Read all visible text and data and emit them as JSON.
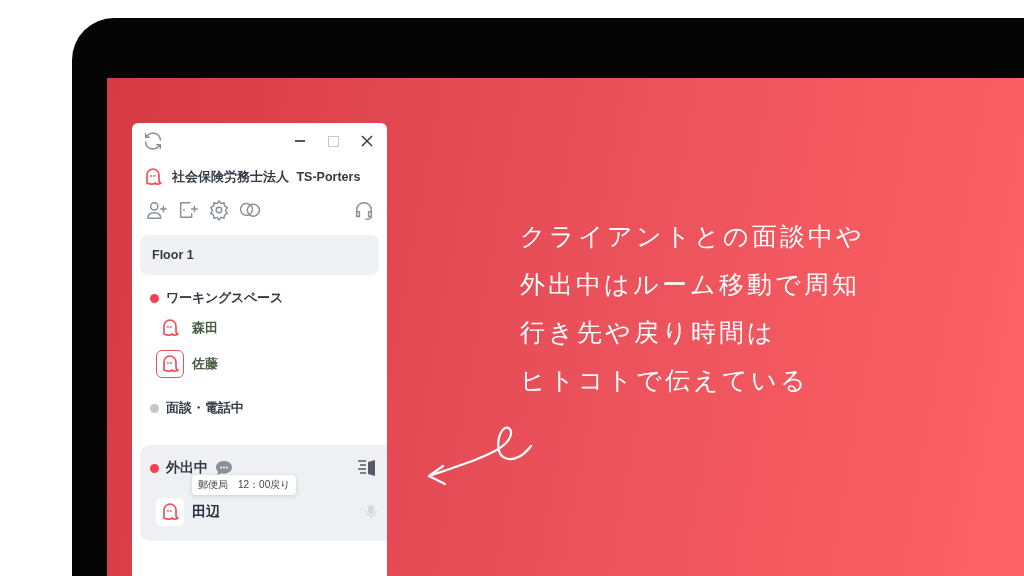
{
  "app": {
    "org_name": "社会保険労務士法人",
    "org_code": "TS-Porters",
    "floor": "Floor 1",
    "rooms": [
      {
        "name": "ワーキングスペース",
        "color": "#f0434f",
        "selected": false,
        "members": [
          {
            "name": "森田",
            "selected": false
          },
          {
            "name": "佐藤",
            "selected": true
          }
        ]
      },
      {
        "name": "面談・電話中",
        "color": "#c4c6cc",
        "selected": false
      },
      {
        "name": "外出中",
        "color": "#f0434f",
        "selected": true,
        "has_messages": true,
        "members": [
          {
            "name": "田辺",
            "selected": false,
            "status_message": "郵便局　12：00戻り"
          }
        ]
      }
    ]
  },
  "caption": [
    "クライアントとの面談中や",
    "外出中はルーム移動で周知",
    "行き先や戻り時間は",
    "ヒトコトで伝えている"
  ]
}
